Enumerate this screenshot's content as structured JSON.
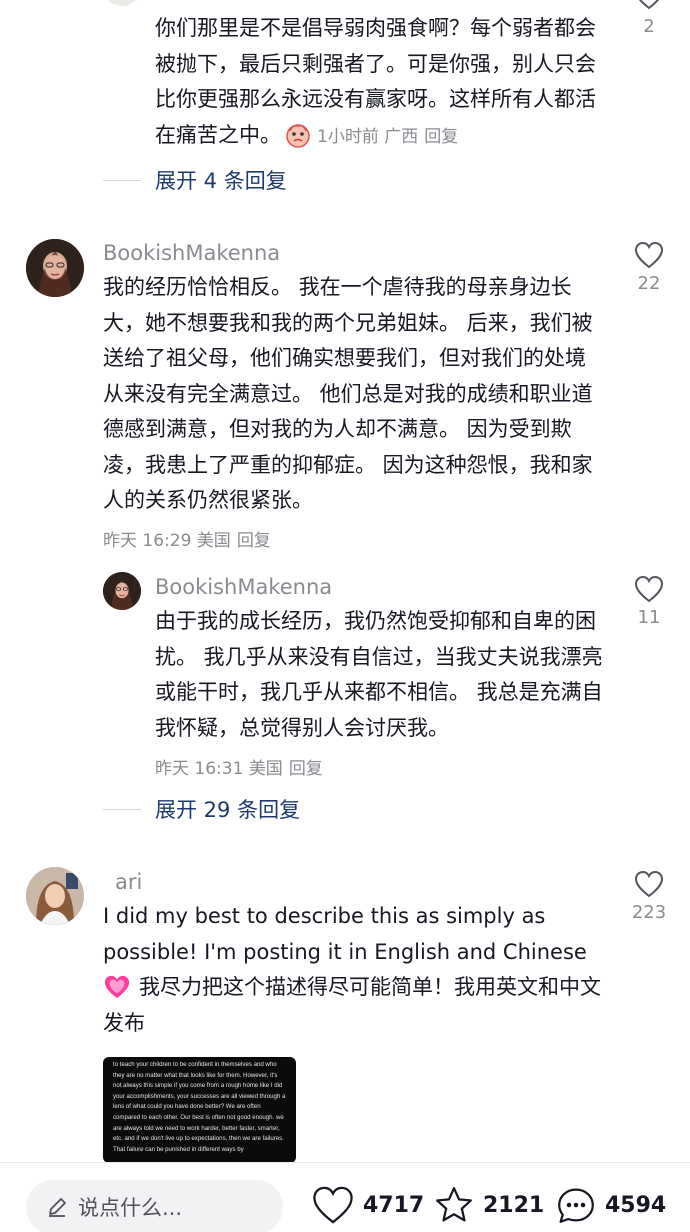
{
  "comments": [
    {
      "text": "你们那里是不是倡导弱肉强食啊？每个弱者都会被抛下，最后只剩强者了。可是你强，别人只会比你更强那么永远没有赢家呀。这样所有人都活在痛苦之中。",
      "emoji_icon": "cry-face-icon",
      "time": "1小时前",
      "location": "广西",
      "reply_label": "回复",
      "likes": "2"
    },
    {
      "username": "BookishMakenna",
      "text": "我的经历恰恰相反。 我在一个虐待我的母亲身边长大，她不想要我和我的两个兄弟姐妹。 后来，我们被送给了祖父母，他们确实想要我们，但对我们的处境从来没有完全满意过。 他们总是对我的成绩和职业道德感到满意，但对我的为人却不满意。 因为受到欺凌，我患上了严重的抑郁症。 因为这种怨恨，我和家人的关系仍然很紧张。",
      "time": "昨天 16:29",
      "location": "美国",
      "reply_label": "回复",
      "likes": "22"
    },
    {
      "username": "BookishMakenna",
      "text": "由于我的成长经历，我仍然饱受抑郁和自卑的困扰。 我几乎从来没有自信过，当我丈夫说我漂亮或能干时，我几乎从来都不相信。 我总是充满自我怀疑，总觉得别人会讨厌我。",
      "time": "昨天 16:31",
      "location": "美国",
      "reply_label": "回复",
      "likes": "11"
    },
    {
      "username": "ari",
      "text_en": "I did my best to describe this as simply as possible! I'm posting it in English and Chinese",
      "emoji_icon": "pink-heart-icon",
      "text_cn": "我尽力把这个描述得尽可能简单！我用英文和中文发布",
      "likes": "223"
    }
  ],
  "expand_1": "展开 4 条回复",
  "expand_2": "展开 29 条回复",
  "thumbnail_text": "to teach your children to be confident in themselves and who they are no matter what that looks like for them. However, it's not always this simple if you come from a rough home like I did your accomplishments, your successes are all viewed through a lens of what could you have done better? We are often compared to each other. Our best is often not good enough. we are always told we need to work harder, better faster, smarter, etc. and if we don't live up to expectations, then we are failures. That failure can be punished in different ways by",
  "bottom_bar": {
    "input_placeholder": "说点什么...",
    "likes": "4717",
    "favorites": "2121",
    "comments": "4594"
  },
  "colors": {
    "text": "#161823",
    "muted": "#8a8b91",
    "link": "#1e3a6e"
  }
}
